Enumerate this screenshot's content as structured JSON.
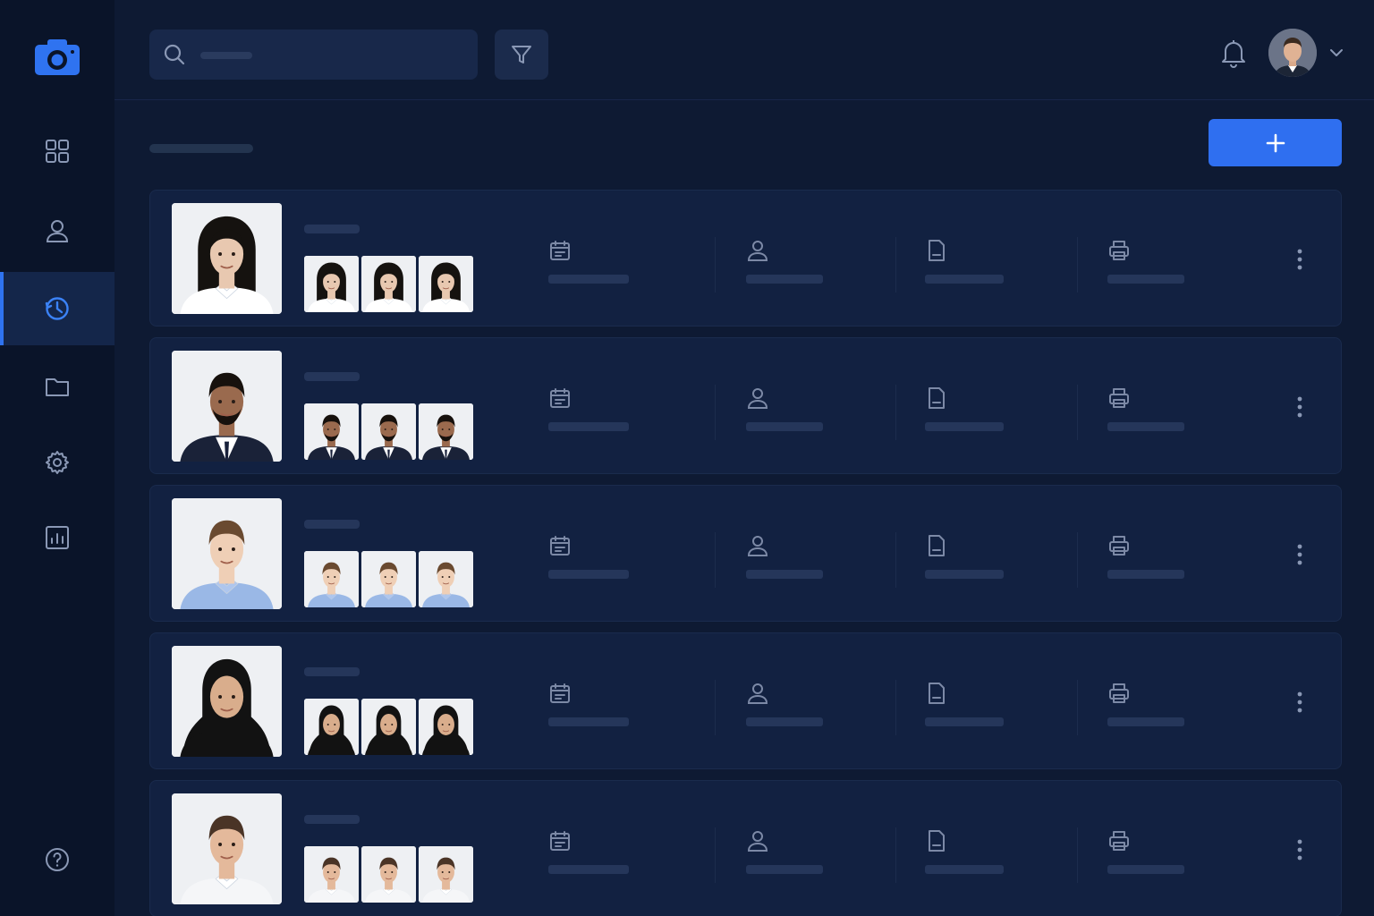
{
  "app": {
    "name": "",
    "accent_color": "#2f6ff0"
  },
  "sidebar": {
    "logo": "camera-icon",
    "items": [
      {
        "name": "dashboard",
        "icon": "grid-icon",
        "active": false
      },
      {
        "name": "profile",
        "icon": "user-icon",
        "active": false
      },
      {
        "name": "history",
        "icon": "clock-icon",
        "active": true
      },
      {
        "name": "folders",
        "icon": "folder-icon",
        "active": false
      },
      {
        "name": "settings",
        "icon": "gear-icon",
        "active": false
      },
      {
        "name": "reports",
        "icon": "chart-icon",
        "active": false
      }
    ],
    "help": "help-icon"
  },
  "topbar": {
    "search": {
      "placeholder": "",
      "icon": "search-icon"
    },
    "filter": "filter-icon",
    "notifications": "bell-icon",
    "user_menu": "chevron-down-icon"
  },
  "main": {
    "add_button": "plus-icon",
    "rows": [
      {
        "subject": "woman-long-hair",
        "skin": "#e8c8b0",
        "hair": "#15120f",
        "clothing": "#ffffff",
        "collar": "#ffffff"
      },
      {
        "subject": "man-beard-suit",
        "skin": "#9a6a4e",
        "hair": "#17110d",
        "clothing": "#1a2238",
        "collar": "#ffffff"
      },
      {
        "subject": "boy-blue-shirt",
        "skin": "#efcfb6",
        "hair": "#6a4a30",
        "clothing": "#9ab8e6",
        "collar": "#aec6ee"
      },
      {
        "subject": "woman-hijab",
        "skin": "#d9ad8c",
        "hair": "#121212",
        "clothing": "#121212",
        "collar": "#121212"
      },
      {
        "subject": "man-white-shirt",
        "skin": "#e4b99b",
        "hair": "#4a3426",
        "clothing": "#f5f6f8",
        "collar": "#ffffff"
      }
    ],
    "columns": [
      "calendar-icon",
      "user-icon",
      "document-icon",
      "printer-icon"
    ]
  }
}
